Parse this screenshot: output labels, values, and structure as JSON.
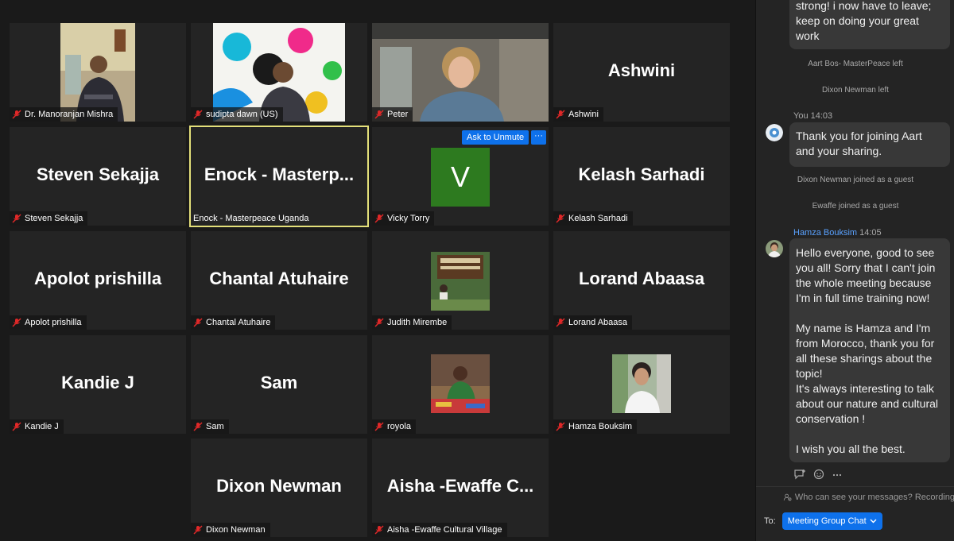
{
  "participants": [
    {
      "label": "Dr. Manoranjan Mishra"
    },
    {
      "label": "sudipta dawn (US)"
    },
    {
      "label": "Peter"
    },
    {
      "label": "Ashwini",
      "big": "Ashwini"
    },
    {
      "label": "Steven Sekajja",
      "big": "Steven Sekajja"
    },
    {
      "label": "Enock - Masterpeace Uganda",
      "big": "Enock  -  Masterp..."
    },
    {
      "label": "Vicky Torry",
      "avatar_letter": "V"
    },
    {
      "label": "Kelash Sarhadi",
      "big": "Kelash Sarhadi"
    },
    {
      "label": "Apolot prishilla",
      "big": "Apolot prishilla"
    },
    {
      "label": "Chantal Atuhaire",
      "big": "Chantal Atuhaire"
    },
    {
      "label": "Judith Mirembe"
    },
    {
      "label": "Lorand Abaasa",
      "big": "Lorand Abaasa"
    },
    {
      "label": "Kandie J",
      "big": "Kandie J"
    },
    {
      "label": "Sam",
      "big": "Sam"
    },
    {
      "label": "royola"
    },
    {
      "label": "Hamza Bouksim"
    },
    {
      "label": "Dixon Newman",
      "big": "Dixon Newman"
    },
    {
      "label": "Aisha -Ewaffe Cultural Village",
      "big": "Aisha  -Ewaffe  C..."
    }
  ],
  "tile_controls": {
    "unmute_label": "Ask to Unmute",
    "more_label": "···"
  },
  "chat": {
    "prev_message_lines": [
      "strong! i now have to leave;",
      "keep on doing your great",
      "work"
    ],
    "system_1": "Aart Bos- MasterPeace left",
    "system_2": "Dixon Newman left",
    "msg1_sender": "You",
    "msg1_time": "14:03",
    "msg1_lines": [
      "Thank you for joining Aart",
      "and your sharing."
    ],
    "system_3": "Dixon Newman joined as a guest",
    "system_4": "Ewaffe joined as a guest",
    "msg2_sender": "Hamza Bouksim",
    "msg2_time": "14:05",
    "msg2_lines": [
      "Hello everyone, good to see",
      "you all! Sorry that I can't join",
      "the whole meeting because",
      "I'm in full time training now!",
      "",
      "My name is Hamza and I'm",
      "from Morocco, thank you for",
      "all these sharings about the",
      "topic!",
      "It's always interesting to talk",
      "about our nature and cultural",
      "conservation !",
      "",
      "I wish you all the best."
    ],
    "privacy_text": "Who can see your messages? Recording",
    "to_label": "To:",
    "to_value": "Meeting Group Chat"
  },
  "colors": {
    "accent": "#0e71eb",
    "active_speaker": "#e4e07a",
    "tile_bg": "#242424",
    "mic_off": "#e02828"
  },
  "icons": [
    "mic-muted-icon",
    "reaction-icon",
    "emoji-icon",
    "more-icon",
    "people-icon",
    "chevron-down-icon"
  ]
}
